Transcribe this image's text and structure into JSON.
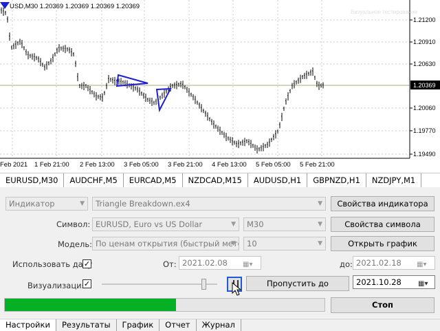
{
  "chart": {
    "header": "USD,M30  1.20369 1.20369 1.20369 1.20369",
    "corner_text": "Визуальное тестирование",
    "price_labels": [
      "1.21200",
      "1.20910",
      "1.20630",
      "1.20369",
      "1.20060",
      "1.19770",
      "1.19490"
    ],
    "time_labels": [
      "Feb 2021",
      "1 Feb 21:00",
      "2 Feb 13:00",
      "3 Feb 05:00",
      "3 Feb 21:00",
      "4 Feb 13:00",
      "5 Feb 05:00",
      "5 Feb 21:00"
    ],
    "current_price": "1.20369",
    "colors": {
      "candles": "#000000",
      "triangles": "#1e1ed2",
      "grid": "#c8c8c8",
      "price_line": "#b0a878"
    }
  },
  "symbol_tabs": [
    "EURUSD,M30",
    "AUDCHF,M5",
    "EURCAD,M5",
    "NZDCAD,M15",
    "AUDUSD,H1",
    "GBPNZD,H1",
    "NZDJPY,M1"
  ],
  "settings": {
    "type_value": "Индикатор",
    "file_value": "Triangle Breakdown.ex4",
    "indicator_props_button": "Свойства индикатора",
    "symbol_label": "Символ:",
    "symbol_value": "EURUSD, Euro vs US Dollar",
    "period_value": "M30",
    "symbol_props_button": "Свойства символа",
    "model_label": "Модель:",
    "model_value": "По ценам открытия (быстрый метод н",
    "spread_value": "10",
    "open_chart_button": "Открыть график",
    "use_date_label": "Использовать дату",
    "use_date_checked": "✓",
    "from_label": "От:",
    "from_value": "2021.02.08",
    "to_label": "до:",
    "to_value": "2021.02.18",
    "visualization_label": "Визуализация",
    "visualization_checked": "✓",
    "speed_level": 0.9,
    "skip_to_button": "Пропустить до",
    "skip_date_value": "2021.10.28",
    "progress": 0.535,
    "stop_button": "Стоп"
  },
  "bottom_tabs": [
    "Настройки",
    "Результаты",
    "График",
    "Отчет",
    "Журнал"
  ]
}
